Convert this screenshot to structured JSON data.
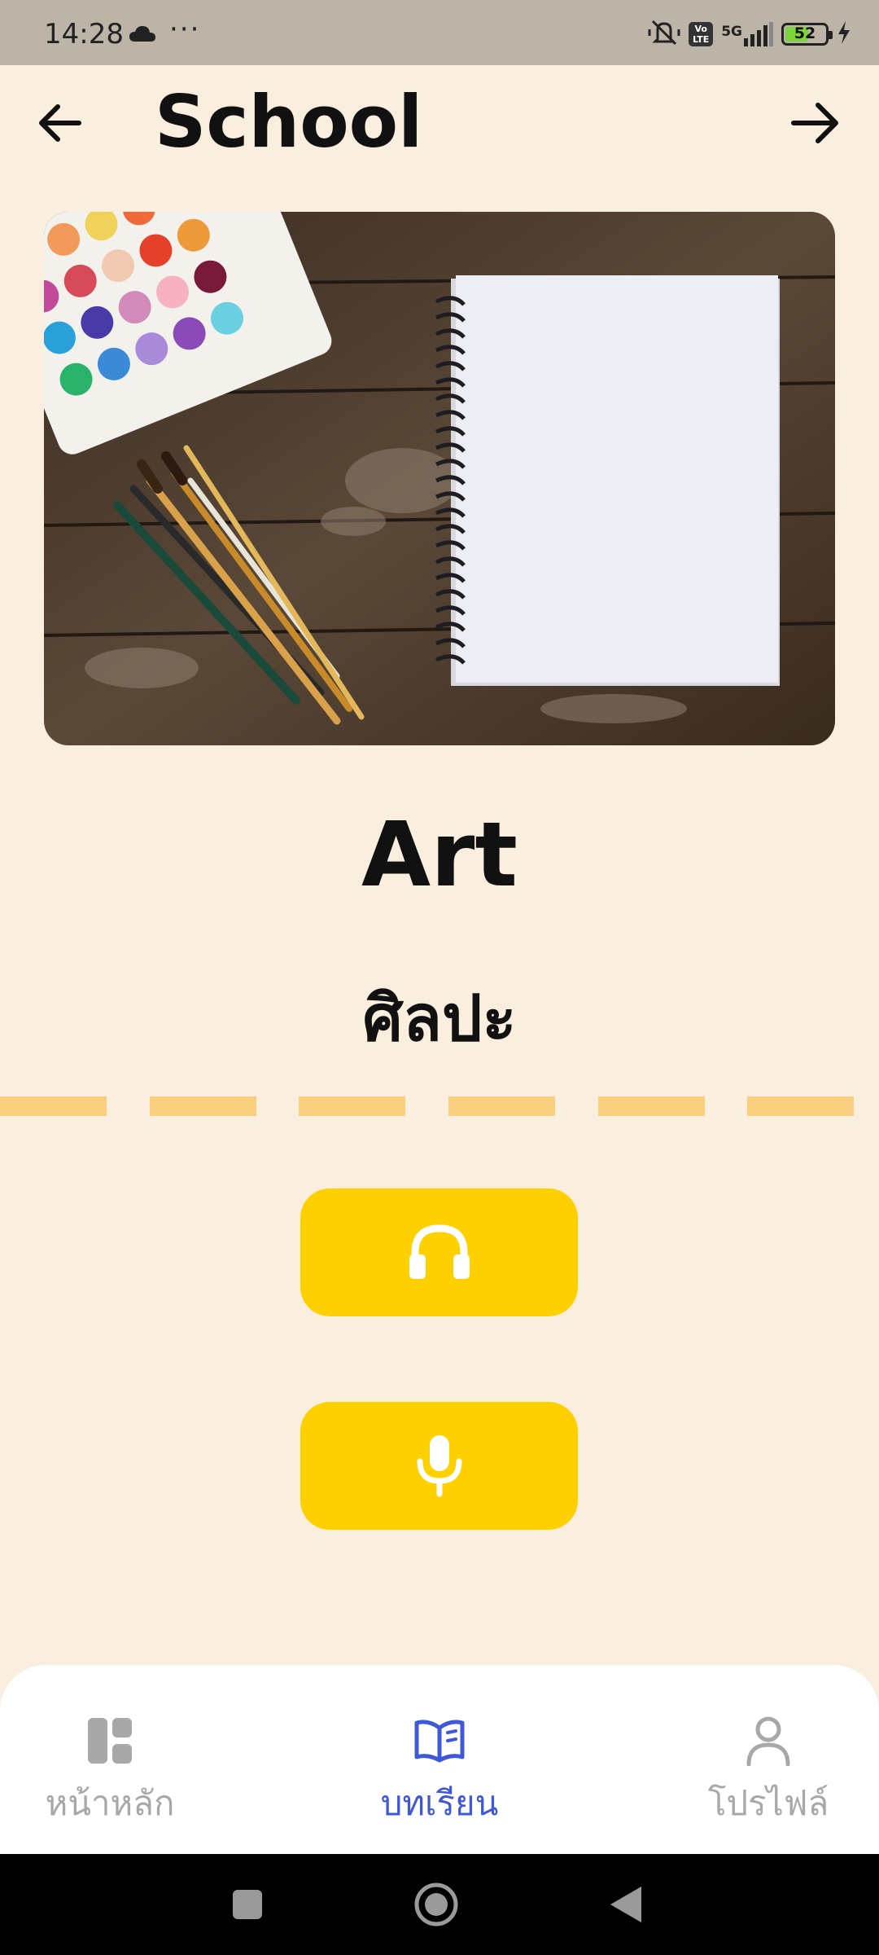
{
  "status_bar": {
    "time": "14:28",
    "volte": "Vo LTE",
    "network": "5G",
    "battery": "52",
    "icons": [
      "cloud-icon",
      "more-icon",
      "mute-icon",
      "signal-icon",
      "battery-icon",
      "charging-icon"
    ]
  },
  "header": {
    "title": "School",
    "back_icon": "arrow-left-icon",
    "forward_icon": "arrow-right-icon"
  },
  "card": {
    "image": "paint-palette-brushes-notebook-photo",
    "word_en": "Art",
    "word_th": "ศิลปะ",
    "divider_color": "#F9CE7E",
    "listen_icon": "headphones-icon",
    "speak_icon": "microphone-icon",
    "button_color": "#FFD000"
  },
  "bottom_nav": {
    "items": [
      {
        "label": "หน้าหลัก",
        "icon": "dashboard-icon",
        "active": false
      },
      {
        "label": "บทเรียน",
        "icon": "book-icon",
        "active": true
      },
      {
        "label": "โปรไฟล์",
        "icon": "user-icon",
        "active": false
      }
    ],
    "active_color": "#3F57D9",
    "inactive_color": "#A8A8A8"
  },
  "colors": {
    "background": "#FAEEDF",
    "status_bar": "#BDB4A8"
  }
}
